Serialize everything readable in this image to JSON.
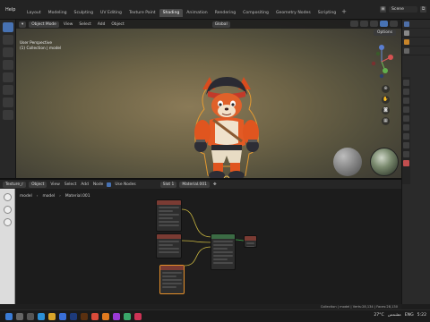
{
  "menu": {
    "help": "Help"
  },
  "tabs": [
    "Layout",
    "Modeling",
    "Sculpting",
    "UV Editing",
    "Texture Paint",
    "Shading",
    "Animation",
    "Rendering",
    "Compositing",
    "Geometry Nodes",
    "Scripting"
  ],
  "active_tab": "Shading",
  "scene": {
    "label": "Scene"
  },
  "viewport": {
    "mode": "Object Mode",
    "menus": [
      "View",
      "Select",
      "Add",
      "Object"
    ],
    "orientation": "Global",
    "options": "Options",
    "info_line1": "User Perspective",
    "info_line2": "(1) Collection | model"
  },
  "node_editor": {
    "editor_label": "Texture_r",
    "object_dd": "Object",
    "menus": [
      "View",
      "Select",
      "Add",
      "Node"
    ],
    "use_nodes": "Use Nodes",
    "slot": "Slot 1",
    "material": "Material.001",
    "breadcrumb": [
      "model",
      "model",
      "Material.001"
    ]
  },
  "status": {
    "text": "Collection | model | Verts:28,134 | Faces:28,130"
  },
  "taskbar": {
    "temp": "27°C",
    "weather": "مشمس",
    "lang": "ENG",
    "time": "5:22"
  },
  "colors": {
    "accent": "#4772b3",
    "active_orange": "#e5902a"
  }
}
